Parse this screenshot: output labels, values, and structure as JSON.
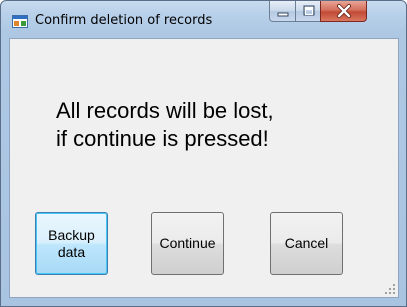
{
  "window": {
    "title": "Confirm deletion of records"
  },
  "caption_buttons": {
    "minimize_icon": "minimize-icon",
    "maximize_icon": "maximize-icon",
    "close_icon": "close-icon"
  },
  "message": {
    "line1": "All records will be lost,",
    "line2": "if continue is pressed!"
  },
  "buttons": {
    "backup": "Backup\ndata",
    "continue": "Continue",
    "cancel": "Cancel"
  },
  "colors": {
    "title_bar": "#b9d1ea",
    "client_background": "#f0f0f0",
    "focused_button_border": "#3c7fb1",
    "close_button": "#c24a35"
  }
}
